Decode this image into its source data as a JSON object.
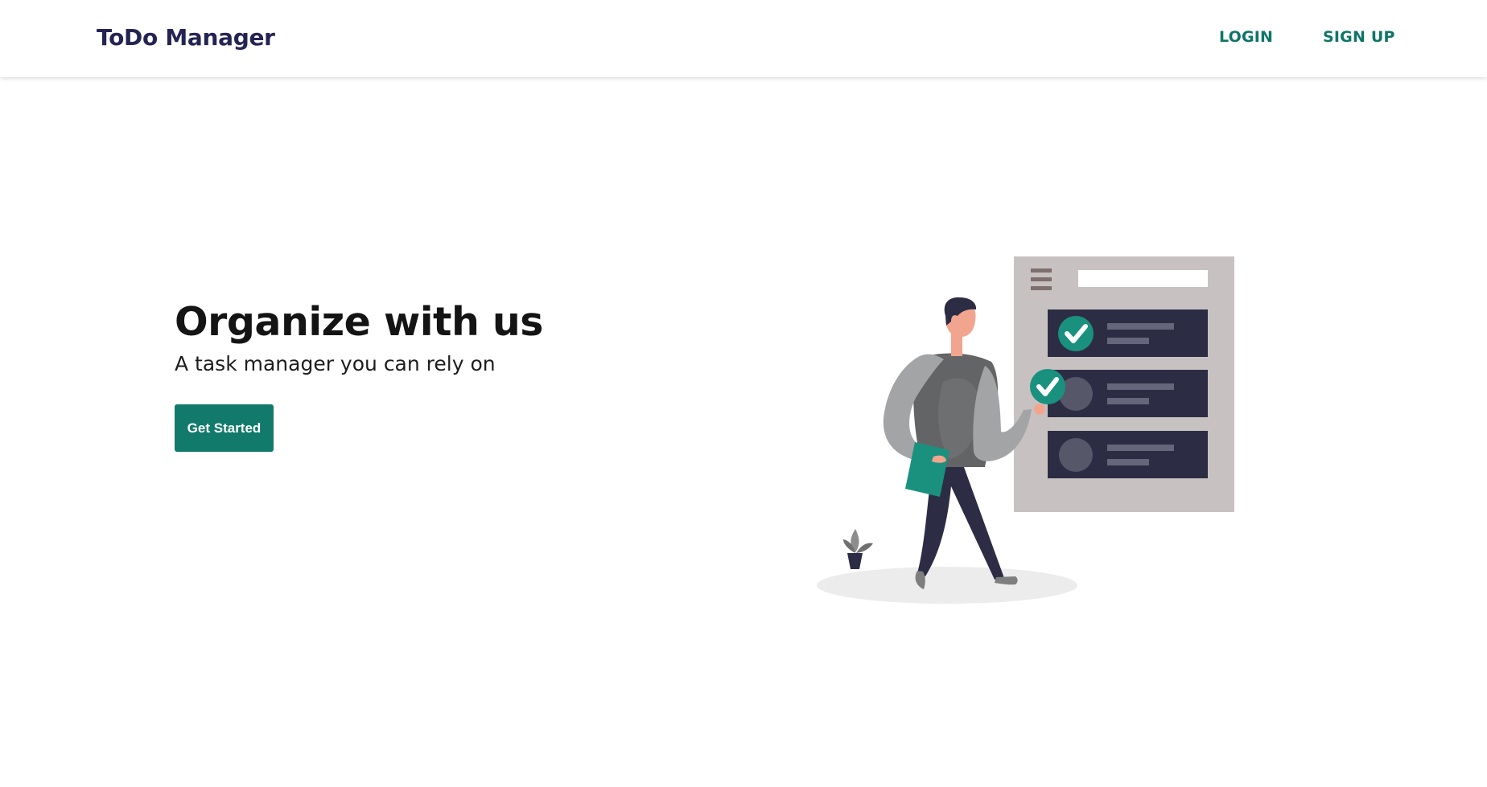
{
  "header": {
    "brand": "ToDo Manager",
    "nav": {
      "login": "LOGIN",
      "signup": "SIGN UP"
    }
  },
  "hero": {
    "title": "Organize with us",
    "subtitle": "A task manager you can rely on",
    "cta_label": "Get Started"
  },
  "illustration": {
    "tasks": [
      {
        "completed": true
      },
      {
        "completed": false
      },
      {
        "completed": false
      }
    ],
    "held_item": "check-icon"
  },
  "colors": {
    "brand": "#232454",
    "accent": "#117a6a",
    "panel": "#c7c2c1",
    "task_card": "#2c2d44",
    "check": "#1a917f"
  }
}
